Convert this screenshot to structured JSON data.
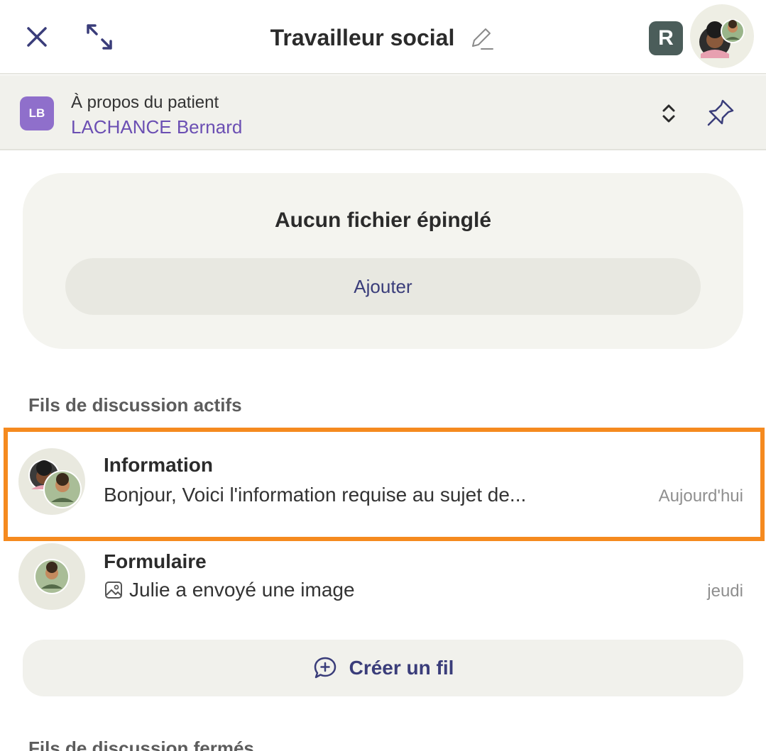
{
  "header": {
    "title": "Travailleur social",
    "close_icon": "close-icon",
    "expand_icon": "expand-icon",
    "edit_icon": "pencil-icon",
    "badge_letter": "R"
  },
  "patient": {
    "label": "À propos du patient",
    "name": "LACHANCE Bernard",
    "initials": "LB"
  },
  "pinned": {
    "title": "Aucun fichier épinglé",
    "add_label": "Ajouter"
  },
  "active_section": {
    "title": "Fils de discussion actifs"
  },
  "threads": [
    {
      "title": "Information",
      "preview": "Bonjour, Voici l'information requise au sujet de...",
      "date": "Aujourd'hui",
      "highlighted": true
    },
    {
      "title": "Formulaire",
      "preview": "Julie a envoyé une image",
      "date": "jeudi",
      "preview_icon": "image-icon"
    }
  ],
  "create_thread": {
    "label": "Créer un fil"
  },
  "closed_section": {
    "title": "Fils de discussion fermés"
  },
  "colors": {
    "accent": "#6b4fb3",
    "highlight": "#f58a1f",
    "button_text": "#3a3d7a"
  }
}
